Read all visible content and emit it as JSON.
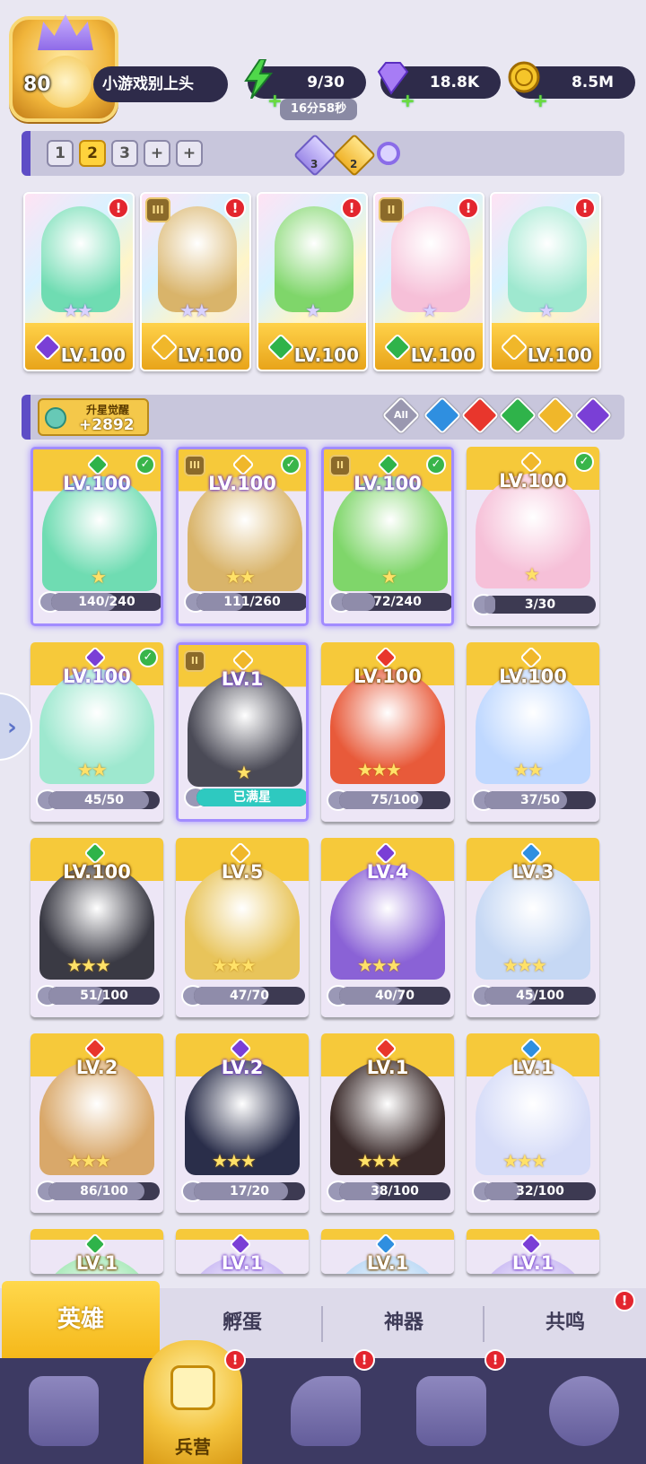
{
  "header": {
    "player_level": "80",
    "player_name": "小游戏别上头",
    "stamina": "9/30",
    "stamina_timer": "16分58秒",
    "gems": "18.8K",
    "gold": "8.5M"
  },
  "team_tabs": [
    "1",
    "2",
    "3",
    "+",
    "+"
  ],
  "team_tab_active": "2",
  "tokens": {
    "purple_count": "3",
    "gold_count": "2"
  },
  "team_cards": [
    {
      "level": "LV.100",
      "element": "dark",
      "stars": 2,
      "alert": "!",
      "badge": ""
    },
    {
      "level": "LV.100",
      "element": "light",
      "stars": 2,
      "alert": "!",
      "badge": "III"
    },
    {
      "level": "LV.100",
      "element": "nature",
      "stars": 1,
      "alert": "!",
      "badge": ""
    },
    {
      "level": "LV.100",
      "element": "nature",
      "stars": 1,
      "alert": "!",
      "badge": "II"
    },
    {
      "level": "LV.100",
      "element": "light",
      "stars": 1,
      "alert": "!",
      "badge": ""
    }
  ],
  "awaken": {
    "label": "升星觉醒",
    "count": "+2892"
  },
  "filters": {
    "all_label": "All",
    "elements": [
      "water",
      "fire",
      "nature",
      "light",
      "dark"
    ]
  },
  "heroes": [
    {
      "level": "LV.100",
      "element": "nature",
      "progress": "140/240",
      "ratio": 0.58,
      "check": true,
      "badge": "",
      "selected": true,
      "stars": 1
    },
    {
      "level": "LV.100",
      "element": "light",
      "progress": "111/260",
      "ratio": 0.43,
      "check": true,
      "badge": "III",
      "selected": true,
      "stars": 2
    },
    {
      "level": "LV.100",
      "element": "nature",
      "progress": "72/240",
      "ratio": 0.3,
      "check": true,
      "badge": "II",
      "selected": true,
      "stars": 1
    },
    {
      "level": "LV.100",
      "element": "light",
      "progress": "3/30",
      "ratio": 0.1,
      "check": true,
      "badge": "",
      "selected": false,
      "stars": 1
    },
    {
      "level": "LV.100",
      "element": "dark",
      "progress": "45/50",
      "ratio": 0.9,
      "check": true,
      "badge": "",
      "selected": false,
      "stars": 2
    },
    {
      "level": "LV.1",
      "element": "light",
      "progress": "已满星",
      "ratio": 1,
      "check": false,
      "badge": "II",
      "selected": true,
      "stars": 1,
      "full": true
    },
    {
      "level": "LV.100",
      "element": "fire",
      "progress": "75/100",
      "ratio": 0.75,
      "check": false,
      "badge": "",
      "selected": false,
      "stars": 3
    },
    {
      "level": "LV.100",
      "element": "light",
      "progress": "37/50",
      "ratio": 0.74,
      "check": false,
      "badge": "",
      "selected": false,
      "stars": 2
    },
    {
      "level": "LV.100",
      "element": "nature",
      "progress": "51/100",
      "ratio": 0.51,
      "check": false,
      "badge": "",
      "selected": false,
      "stars": 3
    },
    {
      "level": "LV.5",
      "element": "light",
      "progress": "47/70",
      "ratio": 0.67,
      "check": false,
      "badge": "",
      "selected": false,
      "stars": 3
    },
    {
      "level": "LV.4",
      "element": "dark",
      "progress": "40/70",
      "ratio": 0.57,
      "check": false,
      "badge": "",
      "selected": false,
      "stars": 3
    },
    {
      "level": "LV.3",
      "element": "water",
      "progress": "45/100",
      "ratio": 0.45,
      "check": false,
      "badge": "",
      "selected": false,
      "stars": 3
    },
    {
      "level": "LV.2",
      "element": "fire",
      "progress": "86/100",
      "ratio": 0.86,
      "check": false,
      "badge": "",
      "selected": false,
      "stars": 3
    },
    {
      "level": "LV.2",
      "element": "dark",
      "progress": "17/20",
      "ratio": 0.85,
      "check": false,
      "badge": "",
      "selected": false,
      "stars": 3
    },
    {
      "level": "LV.1",
      "element": "fire",
      "progress": "38/100",
      "ratio": 0.38,
      "check": false,
      "badge": "",
      "selected": false,
      "stars": 3
    },
    {
      "level": "LV.1",
      "element": "water",
      "progress": "32/100",
      "ratio": 0.32,
      "check": false,
      "badge": "",
      "selected": false,
      "stars": 3
    },
    {
      "level": "LV.1",
      "element": "nature",
      "progress": "",
      "ratio": 0,
      "check": false,
      "badge": "",
      "selected": false,
      "stars": 0
    },
    {
      "level": "LV.1",
      "element": "dark",
      "progress": "",
      "ratio": 0,
      "check": false,
      "badge": "",
      "selected": false,
      "stars": 0
    },
    {
      "level": "LV.1",
      "element": "water",
      "progress": "",
      "ratio": 0,
      "check": false,
      "badge": "",
      "selected": false,
      "stars": 0
    },
    {
      "level": "LV.1",
      "element": "dark",
      "progress": "",
      "ratio": 0,
      "check": false,
      "badge": "",
      "selected": false,
      "stars": 0
    }
  ],
  "bottom_tabs": {
    "hero": "英雄",
    "hatch": "孵蛋",
    "artifact": "神器",
    "resonance": "共鸣",
    "resonance_alert": "!"
  },
  "nav": {
    "barracks": "兵营",
    "alert": "!"
  },
  "colors": {
    "nature": "#2fb34a",
    "light": "#f0b72a",
    "dark": "#7a3fd6",
    "fire": "#e8362c",
    "water": "#2f8fe0",
    "accent": "#5e4dc6",
    "gold": "#f6c93a"
  }
}
